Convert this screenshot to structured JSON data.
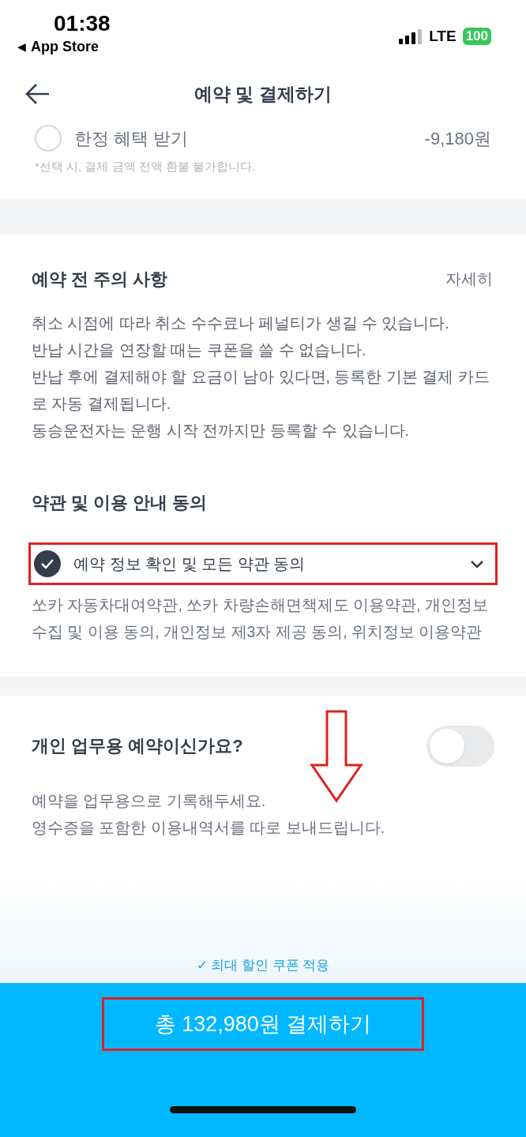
{
  "status_bar": {
    "time": "01:38",
    "back_glyph": "◀",
    "back_app": "App Store",
    "network": "LTE",
    "battery": "100"
  },
  "header": {
    "title": "예약 및 결제하기"
  },
  "benefit": {
    "label": "한정 혜택 받기",
    "amount": "-9,180원",
    "note": "*선택 시, 결제 금액 전액 환불 불가합니다.",
    "selected": false
  },
  "notice": {
    "title": "예약 전 주의 사항",
    "link": "자세히",
    "lines": [
      "취소 시점에 따라 취소 수수료나 페널티가 생길 수 있습니다.",
      "반납 시간을 연장할 때는 쿠폰을 쓸 수 없습니다.",
      "반납 후에 결제해야 할 요금이 남아 있다면, 등록한 기본 결제 카드로 자동 결제됩니다.",
      "동승운전자는 운행 시작 전까지만 등록할 수 있습니다."
    ]
  },
  "terms": {
    "title": "약관 및 이용 안내 동의",
    "agree_all": {
      "label": "예약 정보 확인 및 모든 약관 동의",
      "checked": true,
      "expanded": false
    },
    "description": "쏘카 자동차대여약관, 쏘카 차량손해면책제도 이용약관, 개인정보 수집 및 이용 동의, 개인정보 제3자 제공 동의, 위치정보 이용약관"
  },
  "business": {
    "title": "개인 업무용 예약이신가요?",
    "on": false,
    "lines": [
      "예약을 업무용으로 기록해두세요.",
      "영수증을 포함한 이용내역서를 따로 보내드립니다."
    ]
  },
  "footer": {
    "coupon_note": "✓ 최대 할인 쿠폰 적용",
    "pay_button": "총 132,980원 결제하기"
  }
}
